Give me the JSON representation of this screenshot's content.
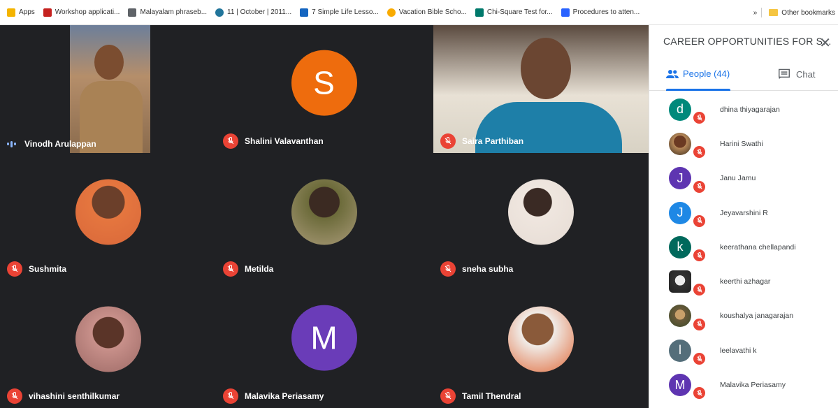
{
  "bookmarks": [
    {
      "label": "Apps",
      "color": "#f4b400"
    },
    {
      "label": "Workshop applicati...",
      "color": "#c5221f"
    },
    {
      "label": "Malayalam phraseb...",
      "color": "#5f6368"
    },
    {
      "label": "11 | October | 2011...",
      "color": "#21759b"
    },
    {
      "label": "7 Simple Life Lesso...",
      "color": "#1565c0"
    },
    {
      "label": "Vacation Bible Scho...",
      "color": "#f9ab00"
    },
    {
      "label": "Chi-Square Test for...",
      "color": "#00796b"
    },
    {
      "label": "Procedures to atten...",
      "color": "#2962ff"
    }
  ],
  "bookmarks_more": "»",
  "other_bookmarks": "Other bookmarks",
  "participants": [
    {
      "name": "Vinodh Arulappan",
      "type": "video",
      "speaking": true
    },
    {
      "name": "Shalini Valavanthan",
      "type": "letter",
      "letter": "S",
      "color": "#ee6c0d"
    },
    {
      "name": "Saira Parthiban",
      "type": "video"
    },
    {
      "name": "Sushmita",
      "type": "photo"
    },
    {
      "name": "Metilda",
      "type": "photo"
    },
    {
      "name": "sneha subha",
      "type": "photo"
    },
    {
      "name": "vihashini senthilkumar",
      "type": "photo"
    },
    {
      "name": "Malavika Periasamy",
      "type": "letter",
      "letter": "M",
      "color": "#6a3cb8"
    },
    {
      "name": "Tamil Thendral",
      "type": "photo"
    }
  ],
  "panel": {
    "title": "CAREER OPPORTUNITIES FOR S...",
    "close": "✕",
    "people_tab": "People (44)",
    "chat_tab": "Chat"
  },
  "people": [
    {
      "name": "dhina thiyagarajan",
      "letter": "d",
      "color": "#00897b"
    },
    {
      "name": "Harini Swathi",
      "letter": "",
      "color": "#8d5a3b"
    },
    {
      "name": "Janu Jamu",
      "letter": "J",
      "color": "#5e35b1"
    },
    {
      "name": "Jeyavarshini R",
      "letter": "J",
      "color": "#1e88e5"
    },
    {
      "name": "keerathana chellapandi",
      "letter": "k",
      "color": "#00695c"
    },
    {
      "name": "keerthi azhagar",
      "letter": "",
      "color": "#3a3a3a"
    },
    {
      "name": "koushalya janagarajan",
      "letter": "",
      "color": "#7a5b3a"
    },
    {
      "name": "leelavathi k",
      "letter": "l",
      "color": "#546e7a"
    },
    {
      "name": "Malavika Periasamy",
      "letter": "M",
      "color": "#5e35b1"
    }
  ]
}
